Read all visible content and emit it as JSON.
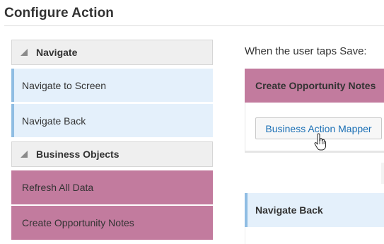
{
  "page": {
    "title": "Configure Action"
  },
  "palette": {
    "groups": [
      {
        "name": "Navigate",
        "items": [
          {
            "label": "Navigate to Screen"
          },
          {
            "label": "Navigate Back"
          }
        ]
      },
      {
        "name": "Business Objects",
        "items": [
          {
            "label": "Refresh All Data"
          },
          {
            "label": "Create Opportunity Notes"
          }
        ]
      }
    ]
  },
  "flow": {
    "trigger_label": "When the user taps Save:",
    "steps": [
      {
        "title": "Create Opportunity Notes",
        "button_label": "Business Action Mapper"
      },
      {
        "title": "Navigate Back"
      }
    ]
  },
  "colors": {
    "navigate_item_bg": "#e4f0fb",
    "navigate_item_accent": "#8fbde3",
    "business_item_bg": "#c27b9e",
    "link_blue": "#1a6fb5"
  }
}
